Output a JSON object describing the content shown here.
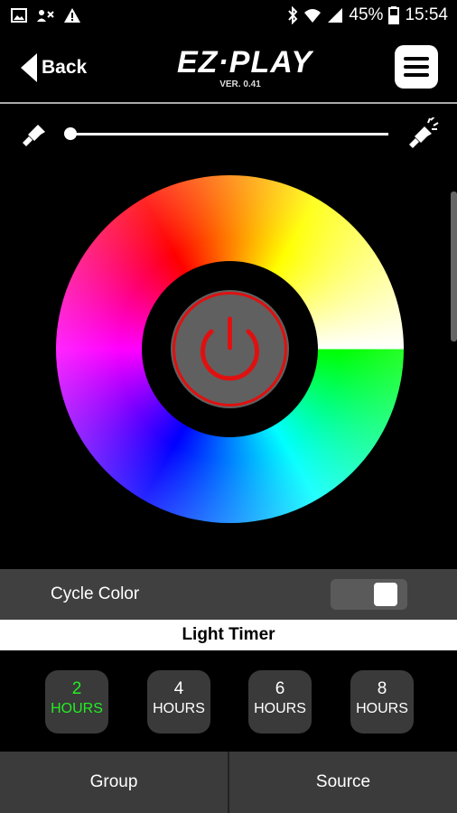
{
  "status_bar": {
    "icons_left": [
      "image-icon",
      "vpn-icon",
      "warning-icon"
    ],
    "icons_right": [
      "bluetooth-icon",
      "wifi-icon",
      "signal-icon"
    ],
    "battery": "45%",
    "time": "15:54"
  },
  "header": {
    "back_label": "Back",
    "logo_text": "EZ·PLAY",
    "version": "VER. 0.41"
  },
  "brightness": {
    "min_icon": "flashlight-dim-icon",
    "max_icon": "flashlight-bright-icon",
    "value": 0.0
  },
  "color_wheel": {
    "center": "power-icon",
    "power_color": "#e01010"
  },
  "cycle_color": {
    "label": "Cycle Color",
    "enabled": true
  },
  "light_timer": {
    "title": "Light Timer",
    "options": [
      {
        "num": "2",
        "unit": "HOURS",
        "active": true
      },
      {
        "num": "4",
        "unit": "HOURS",
        "active": false
      },
      {
        "num": "6",
        "unit": "HOURS",
        "active": false
      },
      {
        "num": "8",
        "unit": "HOURS",
        "active": false
      }
    ],
    "active_color": "#22ee22"
  },
  "bottom_tabs": {
    "group": "Group",
    "source": "Source"
  }
}
